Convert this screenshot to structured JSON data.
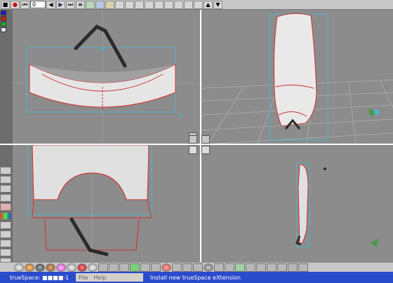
{
  "toolbar": {
    "frame_value": "0",
    "buttons": [
      "stop",
      "record",
      "first-frame",
      "prev-frame",
      "play",
      "next-frame",
      "last-frame",
      "keyframe-list"
    ],
    "symbols": {
      "stop": "■",
      "record": "●",
      "first": "⏮",
      "prev": "◀",
      "next": "▶",
      "last": "⏭"
    }
  },
  "colors": {
    "workspace": "#8c8c8c",
    "mesh_outline": "#d03030",
    "bbox": "#4fb3c8",
    "taskbar": "#2a4bcc"
  },
  "palette": [
    "#1a1ad0",
    "#c82020",
    "#1ab01a",
    "#e8e8e8"
  ],
  "side_tools": [
    "lathe",
    "sweep",
    "bevel",
    "node",
    "paint",
    "material",
    "light",
    "camera",
    "render",
    "mesh",
    "move",
    "scale"
  ],
  "statusbar": {
    "app_title": "trueSpace: ■■■■-1",
    "menu_file": "File",
    "menu_help": "Help",
    "message": "Install new trueSpace eXtension"
  }
}
